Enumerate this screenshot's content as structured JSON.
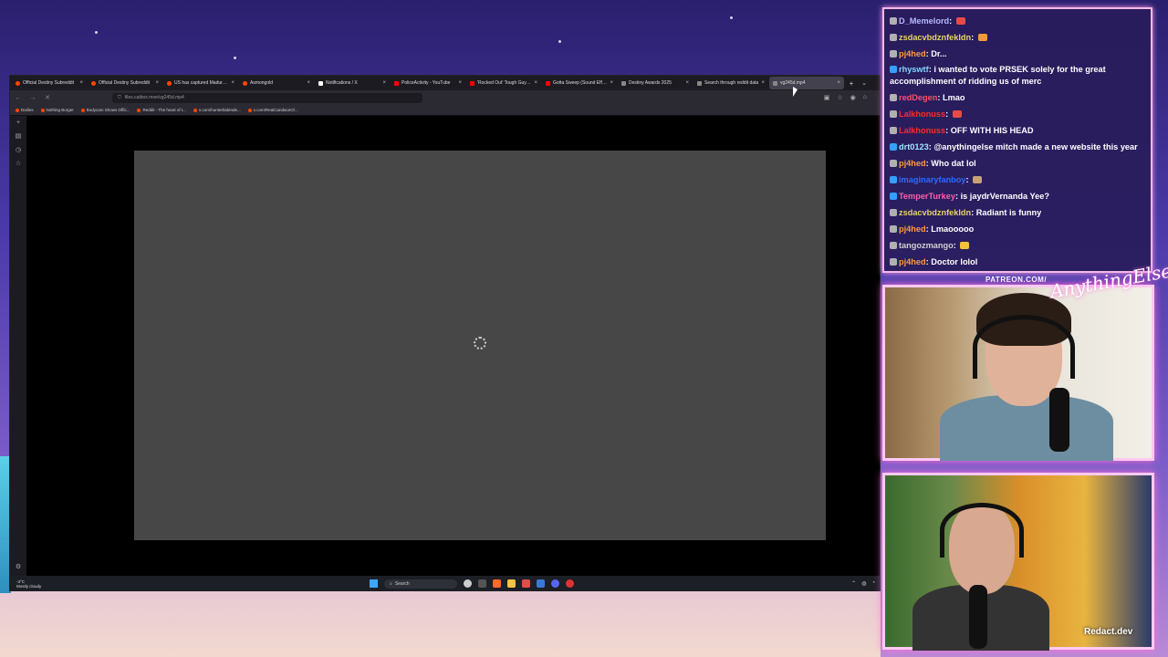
{
  "browser": {
    "tabs": [
      {
        "title": "Official Destiny Subreddit",
        "icon": "reddit-icon"
      },
      {
        "title": "Official Destiny Subreddit",
        "icon": "reddit-icon"
      },
      {
        "title": "US has captured Maduro an",
        "icon": "reddit-icon"
      },
      {
        "title": "Asmongold",
        "icon": "reddit-icon"
      },
      {
        "title": "Notifications / X",
        "icon": "x-icon"
      },
      {
        "title": "PoliceActivity - YouTube",
        "icon": "youtube-icon"
      },
      {
        "title": "'Rocked Out' Tough Guy Fac",
        "icon": "youtube-icon"
      },
      {
        "title": "Gotta Sweep (Sound Effect)",
        "icon": "youtube-icon"
      },
      {
        "title": "Destiny Awards 2025",
        "icon": "doc-icon"
      },
      {
        "title": "Search through reddit data",
        "icon": "doc-icon"
      },
      {
        "title": "vg245d.mp4",
        "icon": "doc-icon",
        "active": true
      }
    ],
    "url": "files.catbox.moe/vg245d.mp4",
    "bookmarks": [
      "Dailies",
      "Nothing Burger",
      "Bodycam Shows Offic...",
      "Reddit - The heart of t...",
      "x.com/hunterbidende...",
      "x.com/RealCandaceO/..."
    ]
  },
  "taskbar": {
    "weather_temp": "-3°C",
    "weather_desc": "Mostly cloudy",
    "search_label": "Search"
  },
  "chat": [
    {
      "user": "D_Memelord",
      "color": "#b9b9ff",
      "text": ""
    },
    {
      "user": "zsdacvbdznfekldn",
      "color": "#e6d36a",
      "text": ""
    },
    {
      "user": "pj4hed",
      "color": "#ff9a3c",
      "text": "Dr..."
    },
    {
      "user": "rhyswtf",
      "color": "#7fd6ff",
      "text": "i wanted to vote PRSEK solely for the great accomplishment of ridding us of merc"
    },
    {
      "user": "redDegen",
      "color": "#ff4d6a",
      "text": "Lmao"
    },
    {
      "user": "Lalkhonuss",
      "color": "#ff2a2a",
      "text": ""
    },
    {
      "user": "Lalkhonuss",
      "color": "#ff2a2a",
      "text": "OFF WITH HIS HEAD"
    },
    {
      "user": "drt0123",
      "color": "#9ee8ff",
      "text": "@anythingelse mitch made a new website this year"
    },
    {
      "user": "pj4hed",
      "color": "#ff9a3c",
      "text": "Who dat lol"
    },
    {
      "user": "imaginaryfanboy",
      "color": "#2d6cff",
      "text": ""
    },
    {
      "user": "TemperTurkey",
      "color": "#ff5fa8",
      "text": "is jaydrVernanda Yee?"
    },
    {
      "user": "zsdacvbdznfekldn",
      "color": "#e6d36a",
      "text": "Radiant is funny"
    },
    {
      "user": "pj4hed",
      "color": "#ff9a3c",
      "text": "Lmaooooo"
    },
    {
      "user": "tangozmango",
      "color": "#cfcfcf",
      "text": ""
    },
    {
      "user": "pj4hed",
      "color": "#ff9a3c",
      "text": "Doctor lolol"
    }
  ],
  "overlay": {
    "patreon": "PATREON.COM/",
    "brand_script": "AnythingElse",
    "redact": "Redact.dev"
  }
}
